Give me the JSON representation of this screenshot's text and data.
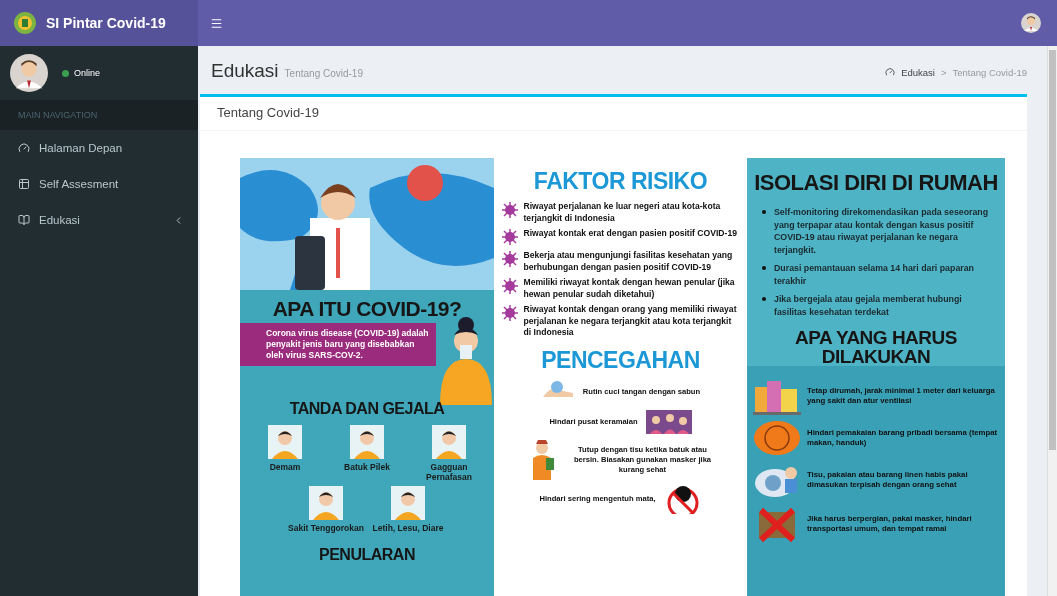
{
  "app": {
    "title": "SI Pintar Covid-19"
  },
  "user": {
    "status": "Online"
  },
  "sidebar": {
    "header": "MAIN NAVIGATION",
    "items": [
      {
        "label": "Halaman Depan",
        "selected": false,
        "submenu": false
      },
      {
        "label": "Self Assesment",
        "selected": false,
        "submenu": false
      },
      {
        "label": "Edukasi",
        "selected": false,
        "submenu": true,
        "expanded": false
      }
    ]
  },
  "page_header": {
    "title": "Edukasi",
    "subtitle": "Tentang Covid-19",
    "breadcrumb": [
      "Edukasi",
      "Tentang Covid-19"
    ],
    "breadcrumb_separator": ">"
  },
  "box": {
    "title": "Tentang Covid-19"
  },
  "infographic": {
    "left": {
      "heading": "APA ITU COVID-19?",
      "description": "Corona virus disease (COVID-19) adalah penyakit jenis baru yang disebabkan oleh virus SARS-COV-2.",
      "symptoms_heading": "TANDA DAN GEJALA",
      "symptoms": [
        "Demam",
        "Batuk Pilek",
        "Gagguan Pernafasan",
        "Sakit Tenggorokan",
        "Letih, Lesu, Diare"
      ],
      "transmission_heading": "PENULARAN"
    },
    "middle": {
      "risk_heading": "FAKTOR RISIKO",
      "risks": [
        "Riwayat perjalanan ke luar negeri atau kota-kota terjangkit di Indonesia",
        "Riwayat kontak erat dengan pasien positif COVID-19",
        "Bekerja atau mengunjungi fasilitas kesehatan yang berhubungan dengan pasien positif COVID-19",
        "Memiliki riwayat kontak dengan hewan penular (jika hewan penular sudah diketahui)",
        "Riwayat kontak dengan orang yang memiliki riwayat perjalanan ke negara terjangkit atau kota terjangkit di Indonesia"
      ],
      "prevention_heading": "PENCEGAHAN",
      "prevention": [
        "Rutin cuci tangan dengan sabun",
        "Hindari pusat keramaian",
        "Tutup dengan tisu ketika batuk atau bersin. Biasakan gunakan masker jika kurang sehat",
        "Hindari sering mengentuh mata,"
      ]
    },
    "right": {
      "isolation_heading": "ISOLASI DIRI DI RUMAH",
      "isolation": [
        "Self-monitoring direkomendasikan pada seseorang yang terpapar atau kontak dengan kasus positif COVID-19 atau riwayat perjalanan ke negara terjangkit.",
        "Durasi pemantauan selama 14 hari dari paparan terakhir",
        "Jika bergejala atau gejala memberat hubungi fasilitas kesehatan terdekat"
      ],
      "todo_heading": "APA YANG HARUS DILAKUKAN",
      "todo": [
        "Tetap dirumah, jarak minimal 1 meter dari keluarga yang sakit dan atur ventilasi",
        "Hindari pemakaian barang pribadi bersama (tempat makan, handuk)",
        "Tisu, pakaian atau barang linen habis pakai dimasukan terpisah dengan orang sehat",
        "Jika harus berpergian, pakai masker, hindari transportasi umum, dan tempat ramai"
      ]
    }
  }
}
